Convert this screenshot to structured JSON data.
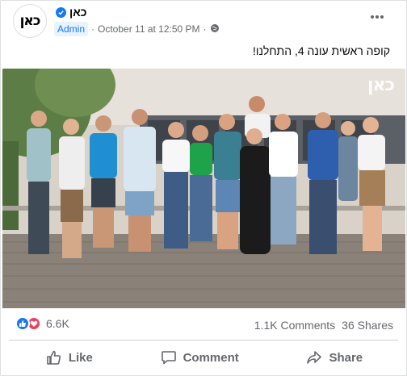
{
  "post": {
    "page_name": "כאן",
    "avatar_logo": "כאן",
    "admin_badge": "Admin",
    "timestamp": "October 11 at 12:50 PM",
    "separator": "·",
    "caption": "קופה ראשית עונה 4, התחלנו!",
    "photo_watermark": "כאן"
  },
  "stats": {
    "reaction_count": "6.6K",
    "comments": "1.1K Comments",
    "shares": "36 Shares"
  },
  "actions": {
    "like": "Like",
    "comment": "Comment",
    "share": "Share"
  },
  "icons": {
    "verified": "verified-badge-icon",
    "privacy": "globe-icon",
    "more": "more-options-icon",
    "like_reaction": "like-reaction-icon",
    "love_reaction": "love-reaction-icon"
  },
  "colors": {
    "brand_blue": "#1877f2",
    "love_red": "#f33e58",
    "secondary_text": "#65676b"
  }
}
